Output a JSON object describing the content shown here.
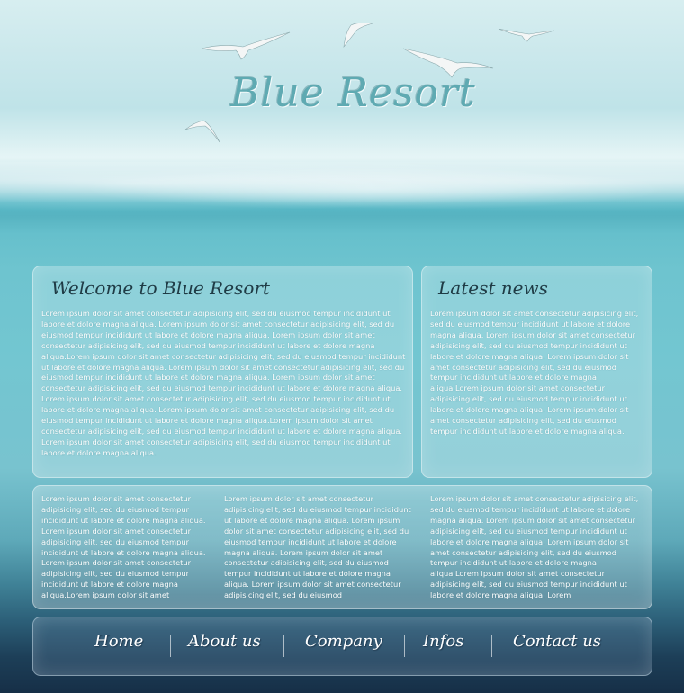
{
  "site": {
    "title": "Blue Resort"
  },
  "welcome": {
    "title": "Welcome to Blue Resort",
    "text": "Lorem ipsum dolor sit amet consectetur adipisicing elit, sed du eiusmod tempur incididunt ut labore et dolore magna aliqua. Lorem ipsum dolor sit amet consectetur adipisicing elit, sed du eiusmod tempur incididunt ut labore et dolore magna aliqua. Lorem ipsum dolor sit amet consectetur adipisicing elit, sed du eiusmod tempur incididunt ut labore et dolore magna aliqua.Lorem ipsum dolor sit amet consectetur adipisicing elit, sed du eiusmod tempur incididunt ut labore et dolore magna aliqua. Lorem ipsum dolor sit amet consectetur adipisicing elit, sed du eiusmod tempur incididunt ut labore et dolore magna aliqua. Lorem ipsum dolor sit amet consectetur adipisicing elit, sed du eiusmod tempur incididunt ut labore et dolore magna aliqua. Lorem ipsum dolor sit amet consectetur adipisicing elit, sed du eiusmod tempur incididunt ut labore et dolore magna aliqua. Lorem ipsum dolor sit amet consectetur adipisicing elit, sed du eiusmod tempur incididunt ut labore et dolore magna aliqua.Lorem ipsum dolor sit amet consectetur adipisicing elit, sed du eiusmod tempur incididunt ut labore et dolore magna aliqua. Lorem ipsum dolor sit amet consectetur adipisicing elit, sed du eiusmod tempur incididunt ut labore et dolore magna aliqua."
  },
  "news": {
    "title": "Latest news",
    "text": "Lorem ipsum dolor sit amet consectetur adipisicing elit, sed du eiusmod tempur incididunt ut labore et dolore magna aliqua. Lorem ipsum dolor sit amet consectetur adipisicing elit, sed du eiusmod tempur incididunt ut labore et dolore magna aliqua. Lorem ipsum dolor sit amet consectetur adipisicing elit, sed du eiusmod tempur incididunt ut labore et dolore magna aliqua.Lorem ipsum dolor sit amet consectetur adipisicing elit, sed du eiusmod tempur incididunt ut labore et dolore magna aliqua. Lorem ipsum dolor sit amet consectetur adipisicing elit, sed du eiusmod tempur incididunt ut labore et dolore magna aliqua."
  },
  "columns": [
    {
      "text": "Lorem ipsum dolor sit amet consectetur adipisicing elit, sed du eiusmod tempur incididunt ut labore et dolore magna aliqua. Lorem ipsum dolor sit amet consectetur adipisicing elit, sed du eiusmod tempur incididunt ut labore et dolore magna aliqua. Lorem ipsum dolor sit amet consectetur adipisicing elit, sed du eiusmod tempur incididunt ut labore et dolore magna aliqua.Lorem ipsum dolor sit amet"
    },
    {
      "text": "Lorem ipsum dolor sit amet consectetur adipisicing elit, sed du eiusmod tempur incididunt ut labore et dolore magna aliqua. Lorem ipsum dolor sit amet consectetur adipisicing elit, sed du eiusmod tempur incididunt ut labore et dolore magna aliqua. Lorem ipsum dolor sit amet consectetur adipisicing elit, sed du eiusmod tempur incididunt ut labore et dolore magna aliqua. Lorem ipsum dolor sit amet consectetur adipisicing elit, sed du eiusmod"
    },
    {
      "text": "Lorem ipsum dolor sit amet consectetur adipisicing elit, sed du eiusmod tempur incididunt ut labore et dolore magna aliqua. Lorem ipsum dolor sit amet consectetur adipisicing elit, sed du eiusmod tempur incididunt ut labore et dolore magna aliqua. Lorem ipsum dolor sit amet consectetur adipisicing elit, sed du eiusmod tempur incididunt ut labore et dolore magna aliqua.Lorem ipsum dolor sit amet consectetur adipisicing elit, sed du eiusmod tempur incididunt ut labore et dolore magna aliqua. Lorem"
    }
  ],
  "nav": {
    "items": [
      {
        "label": "Home"
      },
      {
        "label": "About us"
      },
      {
        "label": "Company"
      },
      {
        "label": "Infos"
      },
      {
        "label": "Contact us"
      }
    ]
  },
  "colors": {
    "panel_title": "#1f3b45",
    "logo": "#5faab2",
    "text": "#ffffff"
  }
}
